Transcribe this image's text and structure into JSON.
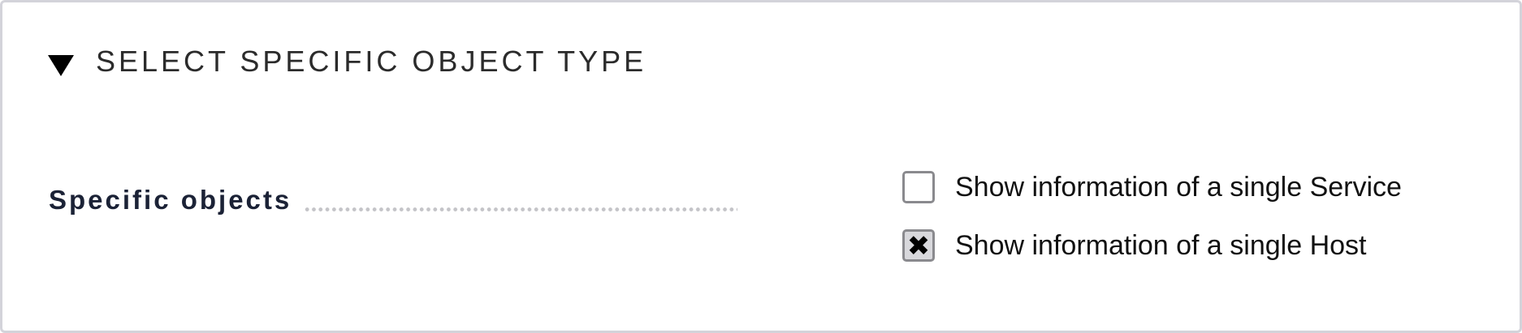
{
  "section": {
    "title": "SELECT SPECIFIC OBJECT TYPE",
    "toggle_icon": "triangle-down-icon",
    "expanded": true
  },
  "field": {
    "label": "Specific objects"
  },
  "options": [
    {
      "label": "Show information of a single Service",
      "checked": false
    },
    {
      "label": "Show information of a single Host",
      "checked": true,
      "mark": "✖"
    }
  ],
  "colors": {
    "panel_border": "#d3d3da",
    "label_text": "#1b2236",
    "checkbox_checked_bg": "#d8d8dc"
  }
}
